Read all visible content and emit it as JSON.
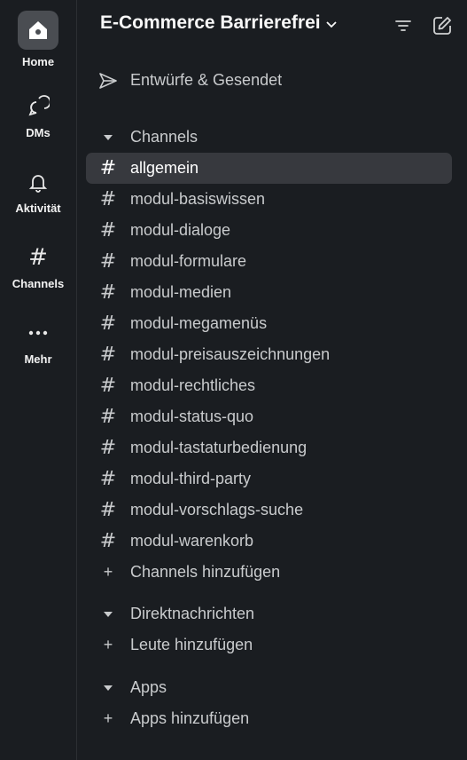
{
  "rail": {
    "items": [
      {
        "label": "Home",
        "icon": "home-icon",
        "active": true
      },
      {
        "label": "DMs",
        "icon": "dms-icon",
        "active": false
      },
      {
        "label": "Aktivität",
        "icon": "bell-icon",
        "active": false
      },
      {
        "label": "Channels",
        "icon": "hash-icon",
        "active": false
      },
      {
        "label": "Mehr",
        "icon": "more-icon",
        "active": false
      }
    ]
  },
  "header": {
    "workspace": "E-Commerce Barrierefrei"
  },
  "drafts": {
    "label": "Entwürfe & Gesendet"
  },
  "channels": {
    "section_label": "Channels",
    "items": [
      "allgemein",
      "modul-basiswissen",
      "modul-dialoge",
      "modul-formulare",
      "modul-medien",
      "modul-megamenüs",
      "modul-preisauszeichnungen",
      "modul-rechtliches",
      "modul-status-quo",
      "modul-tastaturbedienung",
      "modul-third-party",
      "modul-vorschlags-suche",
      "modul-warenkorb"
    ],
    "active": "allgemein",
    "add_label": "Channels hinzufügen"
  },
  "dms": {
    "section_label": "Direktnachrichten",
    "add_label": "Leute hinzufügen"
  },
  "apps": {
    "section_label": "Apps",
    "add_label": "Apps hinzufügen"
  },
  "colors": {
    "background": "#1a1d21",
    "active_row": "#37393e",
    "active_rail": "#4a4d52",
    "text": "#c9cbcd"
  }
}
